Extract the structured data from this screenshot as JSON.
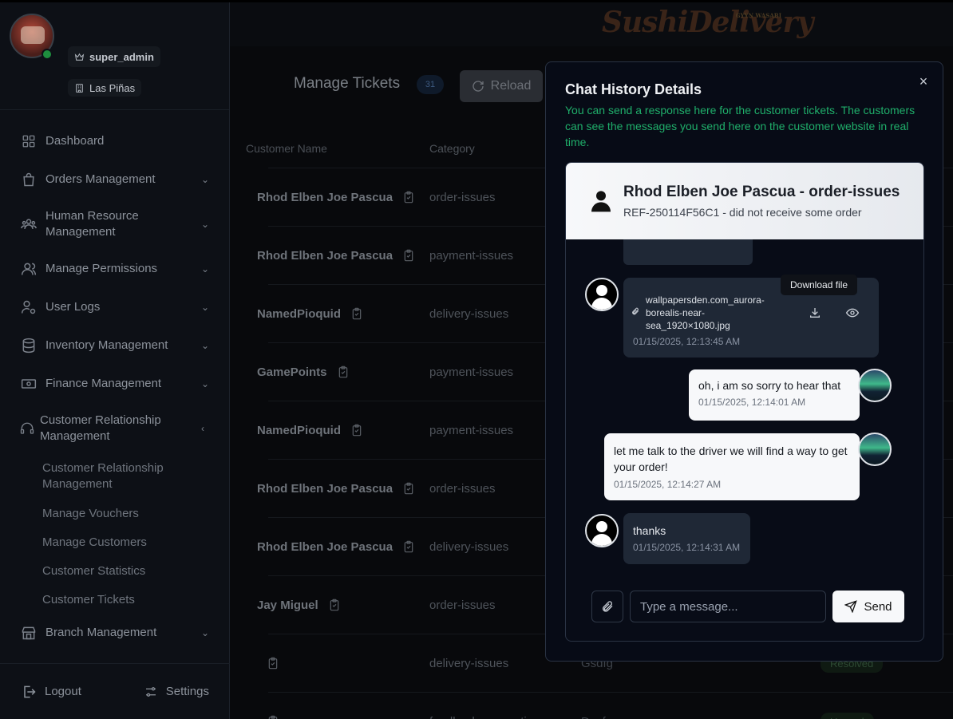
{
  "sidebar": {
    "user": {
      "role": "super_admin",
      "branch": "Las Piñas"
    },
    "nav": [
      {
        "label": "Dashboard",
        "icon": "grid-icon",
        "has_chevron": false
      },
      {
        "label": "Orders Management",
        "icon": "shopping-bag-icon",
        "has_chevron": true
      },
      {
        "label": "Human Resource Management",
        "icon": "users-icon",
        "has_chevron": true
      },
      {
        "label": "Manage Permissions",
        "icon": "user-group-icon",
        "has_chevron": true
      },
      {
        "label": "User Logs",
        "icon": "user-cog-icon",
        "has_chevron": true
      },
      {
        "label": "Inventory Management",
        "icon": "database-icon",
        "has_chevron": true
      },
      {
        "label": "Finance Management",
        "icon": "banknote-icon",
        "has_chevron": true
      },
      {
        "label": "Customer Relationship Management",
        "icon": "headset-icon",
        "has_chevron": true
      }
    ],
    "crm_subitems": [
      "Customer Relationship Management",
      "Manage Vouchers",
      "Manage Customers",
      "Customer Statistics",
      "Customer Tickets"
    ],
    "branch_nav": {
      "label": "Branch Management",
      "icon": "store-icon"
    },
    "logout": "Logout",
    "settings": "Settings"
  },
  "topbar": {
    "logo_text": "SushiDelivery",
    "logo_sub": "GYYN WASABI"
  },
  "main": {
    "title": "Manage Tickets",
    "count": "31",
    "reload_label": "Reload",
    "columns": {
      "name": "Customer Name",
      "category": "Category"
    },
    "rows": [
      {
        "name": "Rhod Elben Joe Pascua",
        "category": "order-issues"
      },
      {
        "name": "Rhod Elben Joe Pascua",
        "category": "payment-issues"
      },
      {
        "name": "NamedPioquid",
        "category": "delivery-issues"
      },
      {
        "name": "GamePoints",
        "category": "payment-issues"
      },
      {
        "name": "NamedPioquid",
        "category": "payment-issues"
      },
      {
        "name": "Rhod Elben Joe Pascua",
        "category": "order-issues"
      },
      {
        "name": "Rhod Elben Joe Pascua",
        "category": "delivery-issues"
      },
      {
        "name": "Jay Miguel",
        "category": "order-issues"
      },
      {
        "name": "",
        "category": "delivery-issues",
        "extra": "Gsdfg",
        "status": "Resolved"
      },
      {
        "name": "",
        "category": "feedback-suggestions",
        "extra": "Dsafw",
        "status": "Unread"
      }
    ]
  },
  "modal": {
    "title": "Chat History Details",
    "description": "You can send a response here for the customer tickets. The customers can see the messages you send here on the customer website in real time.",
    "chat_header": {
      "name": "Rhod Elben Joe Pascua - order-issues",
      "ref": "REF-250114F56C1 - did not receive some order"
    },
    "messages": [
      {
        "type": "file",
        "sender": "customer",
        "file_name": "wallpapersden.com_aurora-borealis-near-sea_1920×1080.jpg",
        "timestamp": "01/15/2025, 12:13:45 AM",
        "tooltip": "Download file"
      },
      {
        "type": "text",
        "sender": "admin",
        "text": "oh, i am so sorry to hear that",
        "timestamp": "01/15/2025, 12:14:01 AM"
      },
      {
        "type": "text",
        "sender": "admin",
        "text": "let me talk to the driver we will find a way to get your order!",
        "timestamp": "01/15/2025, 12:14:27 AM"
      },
      {
        "type": "text",
        "sender": "customer",
        "text": "thanks",
        "timestamp": "01/15/2025, 12:14:31 AM"
      }
    ],
    "composer": {
      "placeholder": "Type a message...",
      "send_label": "Send"
    }
  }
}
